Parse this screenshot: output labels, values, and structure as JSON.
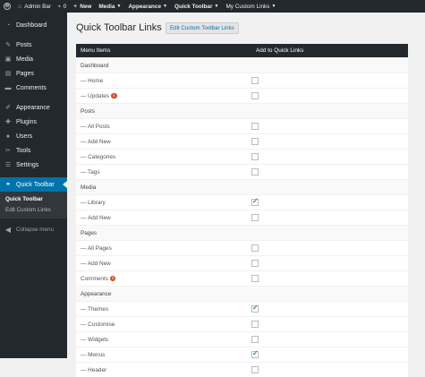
{
  "admin_bar": {
    "site_name": "Admin Bar",
    "comments_count": "0",
    "new_label": "New",
    "media_label": "Media",
    "appearance_label": "Appearance",
    "quick_toolbar_label": "Quick Toolbar",
    "custom_links_label": "My Custom Links"
  },
  "sidebar": {
    "items": [
      {
        "label": "Dashboard",
        "icon": "dashboard-icon"
      },
      {
        "label": "Posts",
        "icon": "pushpin-icon"
      },
      {
        "label": "Media",
        "icon": "media-icon"
      },
      {
        "label": "Pages",
        "icon": "page-icon"
      },
      {
        "label": "Comments",
        "icon": "comment-icon"
      },
      {
        "label": "Appearance",
        "icon": "brush-icon"
      },
      {
        "label": "Plugins",
        "icon": "plug-icon"
      },
      {
        "label": "Users",
        "icon": "user-icon"
      },
      {
        "label": "Tools",
        "icon": "wrench-icon"
      },
      {
        "label": "Settings",
        "icon": "sliders-icon"
      },
      {
        "label": "Quick Toolbar",
        "icon": "link-icon"
      }
    ],
    "submenu": [
      "Quick Toolbar",
      "Edit Custom Links"
    ],
    "collapse_label": "Collapse menu"
  },
  "main": {
    "title": "Quick Toolbar Links",
    "edit_button": "Edit Custom Toolbar Links",
    "table": {
      "headers": [
        "Menu Items",
        "Add to Quick Links"
      ],
      "rows": [
        {
          "label": "Dashboard",
          "section": true
        },
        {
          "label": "— Home",
          "checked": false
        },
        {
          "label": "— Updates",
          "checked": false,
          "badge": "4"
        },
        {
          "label": "Posts",
          "section": true
        },
        {
          "label": "— All Posts",
          "checked": false
        },
        {
          "label": "— Add New",
          "checked": false
        },
        {
          "label": "— Categories",
          "checked": false
        },
        {
          "label": "— Tags",
          "checked": false
        },
        {
          "label": "Media",
          "section": true
        },
        {
          "label": "— Library",
          "checked": true
        },
        {
          "label": "— Add New",
          "checked": false
        },
        {
          "label": "Pages",
          "section": true
        },
        {
          "label": "— All Pages",
          "checked": false
        },
        {
          "label": "— Add New",
          "checked": false
        },
        {
          "label": "Comments",
          "checked": false,
          "badge": "0"
        },
        {
          "label": "Appearance",
          "section": true
        },
        {
          "label": "— Themes",
          "checked": true
        },
        {
          "label": "— Customise",
          "checked": false
        },
        {
          "label": "— Widgets",
          "checked": false
        },
        {
          "label": "— Menus",
          "checked": true
        },
        {
          "label": "— Header",
          "checked": false
        }
      ]
    }
  },
  "colors": {
    "admin_dark": "#23282d",
    "accent_blue": "#0073aa",
    "badge_orange": "#ca4a1f",
    "page_bg": "#f1f1f1"
  }
}
